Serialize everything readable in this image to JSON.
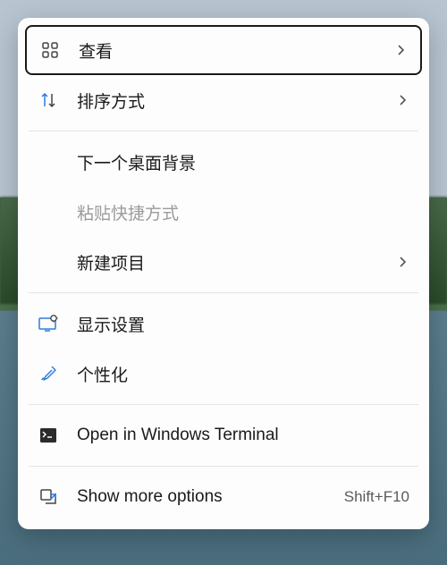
{
  "menu": {
    "items": [
      {
        "label": "查看"
      },
      {
        "label": "排序方式"
      },
      {
        "label": "下一个桌面背景"
      },
      {
        "label": "粘贴快捷方式"
      },
      {
        "label": "新建项目"
      },
      {
        "label": "显示设置"
      },
      {
        "label": "个性化"
      },
      {
        "label": "Open in Windows Terminal"
      },
      {
        "label": "Show more options",
        "accel": "Shift+F10"
      }
    ]
  }
}
